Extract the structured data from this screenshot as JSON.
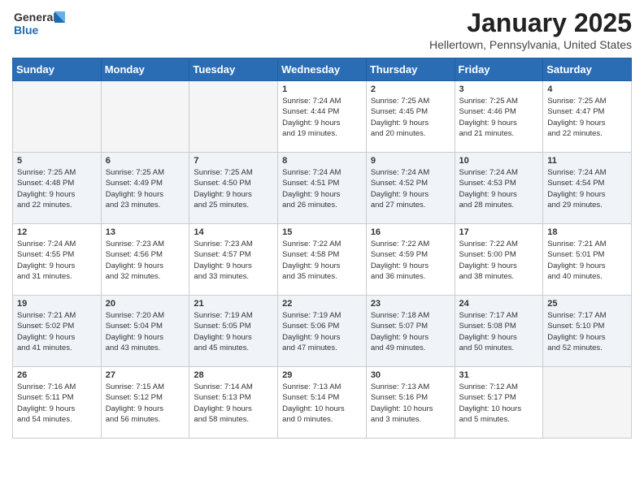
{
  "header": {
    "logo_line1": "General",
    "logo_line2": "Blue",
    "month": "January 2025",
    "location": "Hellertown, Pennsylvania, United States"
  },
  "weekdays": [
    "Sunday",
    "Monday",
    "Tuesday",
    "Wednesday",
    "Thursday",
    "Friday",
    "Saturday"
  ],
  "weeks": [
    [
      {
        "day": "",
        "info": ""
      },
      {
        "day": "",
        "info": ""
      },
      {
        "day": "",
        "info": ""
      },
      {
        "day": "1",
        "info": "Sunrise: 7:24 AM\nSunset: 4:44 PM\nDaylight: 9 hours\nand 19 minutes."
      },
      {
        "day": "2",
        "info": "Sunrise: 7:25 AM\nSunset: 4:45 PM\nDaylight: 9 hours\nand 20 minutes."
      },
      {
        "day": "3",
        "info": "Sunrise: 7:25 AM\nSunset: 4:46 PM\nDaylight: 9 hours\nand 21 minutes."
      },
      {
        "day": "4",
        "info": "Sunrise: 7:25 AM\nSunset: 4:47 PM\nDaylight: 9 hours\nand 22 minutes."
      }
    ],
    [
      {
        "day": "5",
        "info": "Sunrise: 7:25 AM\nSunset: 4:48 PM\nDaylight: 9 hours\nand 22 minutes."
      },
      {
        "day": "6",
        "info": "Sunrise: 7:25 AM\nSunset: 4:49 PM\nDaylight: 9 hours\nand 23 minutes."
      },
      {
        "day": "7",
        "info": "Sunrise: 7:25 AM\nSunset: 4:50 PM\nDaylight: 9 hours\nand 25 minutes."
      },
      {
        "day": "8",
        "info": "Sunrise: 7:24 AM\nSunset: 4:51 PM\nDaylight: 9 hours\nand 26 minutes."
      },
      {
        "day": "9",
        "info": "Sunrise: 7:24 AM\nSunset: 4:52 PM\nDaylight: 9 hours\nand 27 minutes."
      },
      {
        "day": "10",
        "info": "Sunrise: 7:24 AM\nSunset: 4:53 PM\nDaylight: 9 hours\nand 28 minutes."
      },
      {
        "day": "11",
        "info": "Sunrise: 7:24 AM\nSunset: 4:54 PM\nDaylight: 9 hours\nand 29 minutes."
      }
    ],
    [
      {
        "day": "12",
        "info": "Sunrise: 7:24 AM\nSunset: 4:55 PM\nDaylight: 9 hours\nand 31 minutes."
      },
      {
        "day": "13",
        "info": "Sunrise: 7:23 AM\nSunset: 4:56 PM\nDaylight: 9 hours\nand 32 minutes."
      },
      {
        "day": "14",
        "info": "Sunrise: 7:23 AM\nSunset: 4:57 PM\nDaylight: 9 hours\nand 33 minutes."
      },
      {
        "day": "15",
        "info": "Sunrise: 7:22 AM\nSunset: 4:58 PM\nDaylight: 9 hours\nand 35 minutes."
      },
      {
        "day": "16",
        "info": "Sunrise: 7:22 AM\nSunset: 4:59 PM\nDaylight: 9 hours\nand 36 minutes."
      },
      {
        "day": "17",
        "info": "Sunrise: 7:22 AM\nSunset: 5:00 PM\nDaylight: 9 hours\nand 38 minutes."
      },
      {
        "day": "18",
        "info": "Sunrise: 7:21 AM\nSunset: 5:01 PM\nDaylight: 9 hours\nand 40 minutes."
      }
    ],
    [
      {
        "day": "19",
        "info": "Sunrise: 7:21 AM\nSunset: 5:02 PM\nDaylight: 9 hours\nand 41 minutes."
      },
      {
        "day": "20",
        "info": "Sunrise: 7:20 AM\nSunset: 5:04 PM\nDaylight: 9 hours\nand 43 minutes."
      },
      {
        "day": "21",
        "info": "Sunrise: 7:19 AM\nSunset: 5:05 PM\nDaylight: 9 hours\nand 45 minutes."
      },
      {
        "day": "22",
        "info": "Sunrise: 7:19 AM\nSunset: 5:06 PM\nDaylight: 9 hours\nand 47 minutes."
      },
      {
        "day": "23",
        "info": "Sunrise: 7:18 AM\nSunset: 5:07 PM\nDaylight: 9 hours\nand 49 minutes."
      },
      {
        "day": "24",
        "info": "Sunrise: 7:17 AM\nSunset: 5:08 PM\nDaylight: 9 hours\nand 50 minutes."
      },
      {
        "day": "25",
        "info": "Sunrise: 7:17 AM\nSunset: 5:10 PM\nDaylight: 9 hours\nand 52 minutes."
      }
    ],
    [
      {
        "day": "26",
        "info": "Sunrise: 7:16 AM\nSunset: 5:11 PM\nDaylight: 9 hours\nand 54 minutes."
      },
      {
        "day": "27",
        "info": "Sunrise: 7:15 AM\nSunset: 5:12 PM\nDaylight: 9 hours\nand 56 minutes."
      },
      {
        "day": "28",
        "info": "Sunrise: 7:14 AM\nSunset: 5:13 PM\nDaylight: 9 hours\nand 58 minutes."
      },
      {
        "day": "29",
        "info": "Sunrise: 7:13 AM\nSunset: 5:14 PM\nDaylight: 10 hours\nand 0 minutes."
      },
      {
        "day": "30",
        "info": "Sunrise: 7:13 AM\nSunset: 5:16 PM\nDaylight: 10 hours\nand 3 minutes."
      },
      {
        "day": "31",
        "info": "Sunrise: 7:12 AM\nSunset: 5:17 PM\nDaylight: 10 hours\nand 5 minutes."
      },
      {
        "day": "",
        "info": ""
      }
    ]
  ]
}
